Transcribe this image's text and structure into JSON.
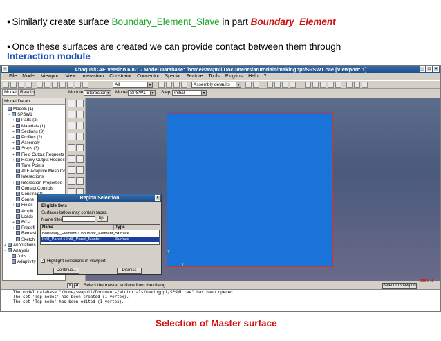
{
  "slide": {
    "bullet1": {
      "prefix": "Similarly create surface ",
      "surface_name": "Boundary_Element_Slave",
      "middle": " in part ",
      "part_name": "Boundary_Element"
    },
    "bullet2": {
      "line1": "Once these surfaces are created we can provide contact between them through",
      "line2": "Interaction module"
    },
    "caption": "Selection of Master surface",
    "bullet_glyph": "●"
  },
  "app": {
    "title": "Abaqus/CAE Version 6.8-1 - Model Database: /home/swapnil/Documents/atutorials/makingppt/SPSW1.cae [Viewport: 1]",
    "menu": [
      "File",
      "Model",
      "Viewport",
      "View",
      "Interaction",
      "Constraint",
      "Connector",
      "Special",
      "Feature",
      "Tools",
      "Plug-ins",
      "Help",
      "?"
    ],
    "toolbar": {
      "render_combo": "All",
      "assembly_combo": "Assembly defaults"
    },
    "context": {
      "module_label": "Module:",
      "module_value": "Interaction",
      "model_label": "Model:",
      "model_value": "SPSW1",
      "step_label": "Step:",
      "step_value": "Initial"
    },
    "tabs": [
      "Model",
      "Results"
    ],
    "tree": {
      "header": "Model Datab",
      "nodes": [
        {
          "label": "Models (1)",
          "depth": 0,
          "exp": "−"
        },
        {
          "label": "SPSW1",
          "depth": 1,
          "exp": "−"
        },
        {
          "label": "Parts (2)",
          "depth": 2,
          "exp": "+"
        },
        {
          "label": "Materials (1)",
          "depth": 2,
          "exp": "+"
        },
        {
          "label": "Sections (3)",
          "depth": 2,
          "exp": "+"
        },
        {
          "label": "Profiles (2)",
          "depth": 2,
          "exp": "+"
        },
        {
          "label": "Assembly",
          "depth": 2,
          "exp": "+"
        },
        {
          "label": "Steps (3)",
          "depth": 2,
          "exp": "+"
        },
        {
          "label": "Field Output Requests (",
          "depth": 2,
          "exp": "+"
        },
        {
          "label": "History Output Requests",
          "depth": 2,
          "exp": "+"
        },
        {
          "label": "Time Points",
          "depth": 2,
          "exp": ""
        },
        {
          "label": "ALE Adaptive Mesh Co",
          "depth": 2,
          "exp": ""
        },
        {
          "label": "Interactions",
          "depth": 2,
          "exp": ""
        },
        {
          "label": "Interaction Properties (1",
          "depth": 2,
          "exp": "+"
        },
        {
          "label": "Contact Controls",
          "depth": 2,
          "exp": ""
        },
        {
          "label": "Constraints",
          "depth": 2,
          "exp": ""
        },
        {
          "label": "Conne",
          "depth": 2,
          "exp": ""
        },
        {
          "label": "Fields",
          "depth": 2,
          "exp": "+"
        },
        {
          "label": "Amplit",
          "depth": 2,
          "exp": ""
        },
        {
          "label": "Loads",
          "depth": 2,
          "exp": ""
        },
        {
          "label": "BCs",
          "depth": 2,
          "exp": "+"
        },
        {
          "label": "Predefi",
          "depth": 2,
          "exp": "+"
        },
        {
          "label": "Remesl",
          "depth": 2,
          "exp": ""
        },
        {
          "label": "Sketch",
          "depth": 2,
          "exp": ""
        },
        {
          "label": "Annotations",
          "depth": 0,
          "exp": "+"
        },
        {
          "label": "Analysis",
          "depth": 0,
          "exp": "−"
        },
        {
          "label": "Jobs",
          "depth": 1,
          "exp": ""
        },
        {
          "label": "Adaptivity",
          "depth": 1,
          "exp": ""
        }
      ]
    },
    "dialog": {
      "title": "Region Selection",
      "section": "Eligible Sets",
      "hint": "Surfaces below may contain faces.",
      "filter_label": "Name filter:",
      "filter_value": "",
      "tip_button": "Tip...",
      "col_name": "Name",
      "col_type": "Type",
      "rows": [
        {
          "name": "Boundary_Element-1.Boundar_Element_Sl",
          "type": "Surface",
          "selected": false
        },
        {
          "name": "Infill_Panel-1.Infill_Panel_Master",
          "type": "Surface",
          "selected": true
        }
      ],
      "highlight_label": "Highlight selections in viewport",
      "highlight_checked": true,
      "continue_button": "Continue...",
      "dismiss_button": "Dismiss"
    },
    "prompt": "Select the master surface from the dialog",
    "select_in_viewport": "Select in Viewport",
    "logo": "SIMULIA",
    "console": [
      "The model database \"/home/swapnil/Documents/atutorials/makingppt/SPSW1.cae\" has been opened.",
      "The set 'Top nodes' has been created (1 vertex).",
      "The set 'Top node' has been edited (1 vertex)."
    ],
    "axes": {
      "y": "Y",
      "x": "X"
    }
  },
  "colors": {
    "surface": "#1a73d9",
    "accent_red": "#d01010",
    "accent_green": "#1aa32a",
    "accent_blue": "#1f4fb8"
  }
}
